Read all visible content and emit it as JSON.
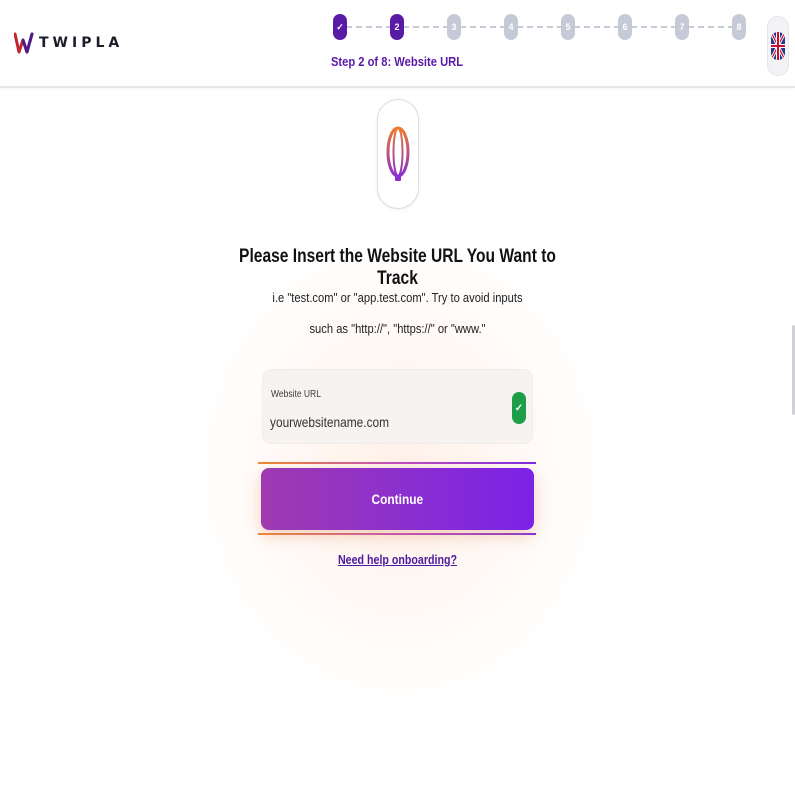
{
  "header": {
    "logo_text": "TWIPLA",
    "steps": [
      {
        "label": "✓",
        "state": "done"
      },
      {
        "label": "2",
        "state": "active"
      },
      {
        "label": "3",
        "state": "pending"
      },
      {
        "label": "4",
        "state": "pending"
      },
      {
        "label": "5",
        "state": "pending"
      },
      {
        "label": "6",
        "state": "pending"
      },
      {
        "label": "7",
        "state": "pending"
      },
      {
        "label": "8",
        "state": "pending"
      }
    ],
    "step_label": "Step 2 of 8: Website URL",
    "language_icon": "uk-flag-icon"
  },
  "main": {
    "icon": "globe-icon",
    "title": "Please Insert the Website URL You Want to Track",
    "subtitle": "i.e \"test.com\" or \"app.test.com\". Try to avoid inputs such as \"http://\", \"https://\" or \"www.\"",
    "field": {
      "label": "Website URL",
      "placeholder": "yourwebsitename.com",
      "value": "",
      "status_icon": "check-icon"
    },
    "continue_label": "Continue",
    "help_link": "Need help onboarding?"
  },
  "colors": {
    "brand_purple": "#5a1aa8",
    "button_gradient_start": "#a03ab0",
    "button_gradient_end": "#7b22e6",
    "accent_orange": "#f08a2a",
    "success_green": "#1f9e4a",
    "step_pending": "#c6cad6"
  }
}
